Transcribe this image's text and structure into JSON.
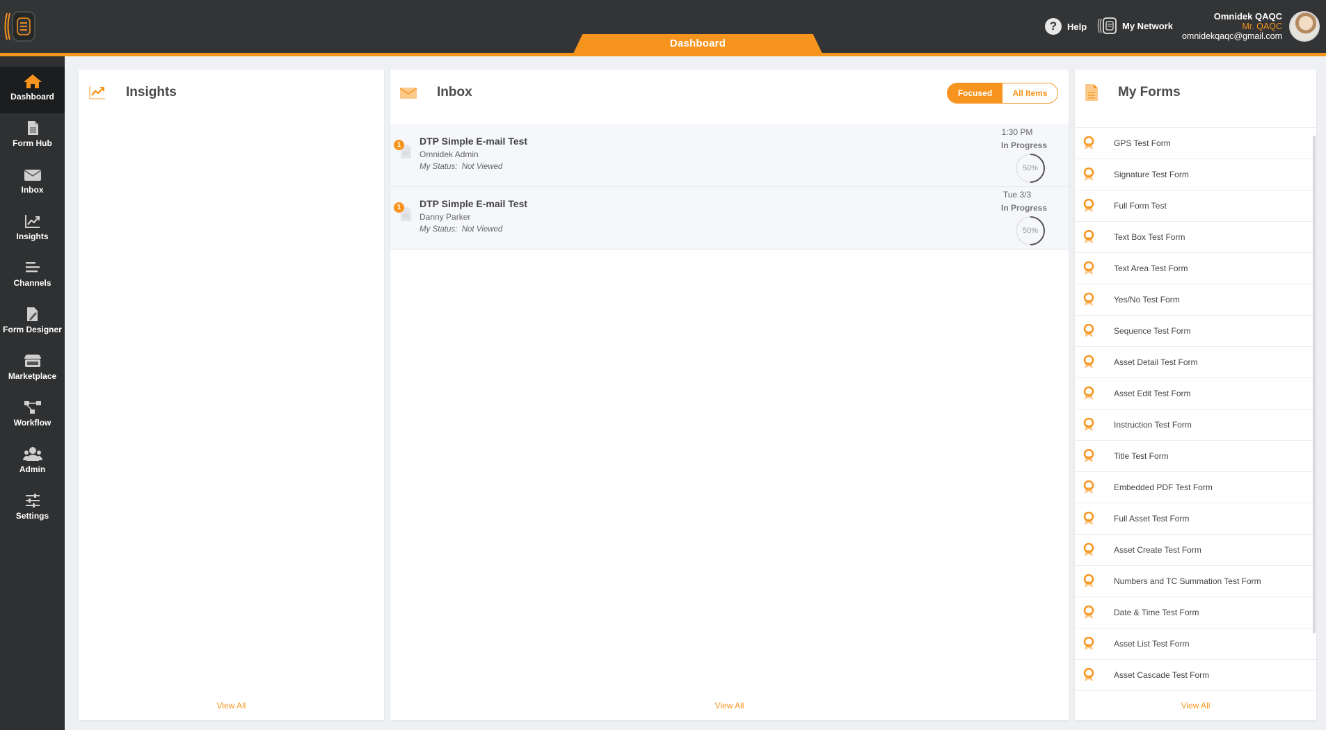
{
  "header": {
    "tab_label": "Dashboard",
    "help_label": "Help",
    "network_label": "My Network",
    "user_name": "Omnidek QAQC",
    "user_title": "Mr. QAQC",
    "user_email": "omnidekqaqc@gmail.com"
  },
  "sidebar": {
    "items": [
      {
        "label": "Dashboard",
        "icon": "home-icon"
      },
      {
        "label": "Form Hub",
        "icon": "document-icon"
      },
      {
        "label": "Inbox",
        "icon": "envelope-icon"
      },
      {
        "label": "Insights",
        "icon": "trend-chart-icon"
      },
      {
        "label": "Channels",
        "icon": "channels-icon"
      },
      {
        "label": "Form Designer",
        "icon": "pencil-document-icon"
      },
      {
        "label": "Marketplace",
        "icon": "store-icon"
      },
      {
        "label": "Workflow",
        "icon": "workflow-icon"
      },
      {
        "label": "Admin",
        "icon": "users-icon"
      },
      {
        "label": "Settings",
        "icon": "sliders-icon"
      }
    ]
  },
  "insights": {
    "title": "Insights",
    "view_all": "View All"
  },
  "inbox": {
    "title": "Inbox",
    "filter_focused": "Focused",
    "filter_all": "All Items",
    "view_all": "View All",
    "messages": [
      {
        "badge": "1",
        "title": "DTP Simple E-mail Test",
        "sender": "Omnidek Admin",
        "status_label": "My Status:",
        "status_value": "Not Viewed",
        "time": "1:30 PM",
        "state": "In Progress",
        "progress_text": "50%",
        "progress": 0.5
      },
      {
        "badge": "1",
        "title": "DTP Simple E-mail Test",
        "sender": "Danny Parker",
        "status_label": "My Status:",
        "status_value": "Not Viewed",
        "time": "Tue 3/3",
        "state": "In Progress",
        "progress_text": "50%",
        "progress": 0.5
      }
    ]
  },
  "forms": {
    "title": "My Forms",
    "view_all": "View All",
    "items": [
      "GPS Test Form",
      "Signature Test Form",
      "Full Form Test",
      "Text Box Test Form",
      "Text Area Test Form",
      "Yes/No Test Form",
      "Sequence Test Form",
      "Asset Detail Test Form",
      "Asset Edit Test Form",
      "Instruction Test Form",
      "Title Test Form",
      "Embedded PDF Test Form",
      "Full Asset Test Form",
      "Asset Create Test Form",
      "Numbers and TC Summation Test Form",
      "Date & Time Test Form",
      "Asset List Test Form",
      "Asset Cascade Test Form"
    ]
  },
  "colors": {
    "accent": "#f7941d",
    "topbar": "#333435",
    "sidebar": "#2f3031"
  }
}
